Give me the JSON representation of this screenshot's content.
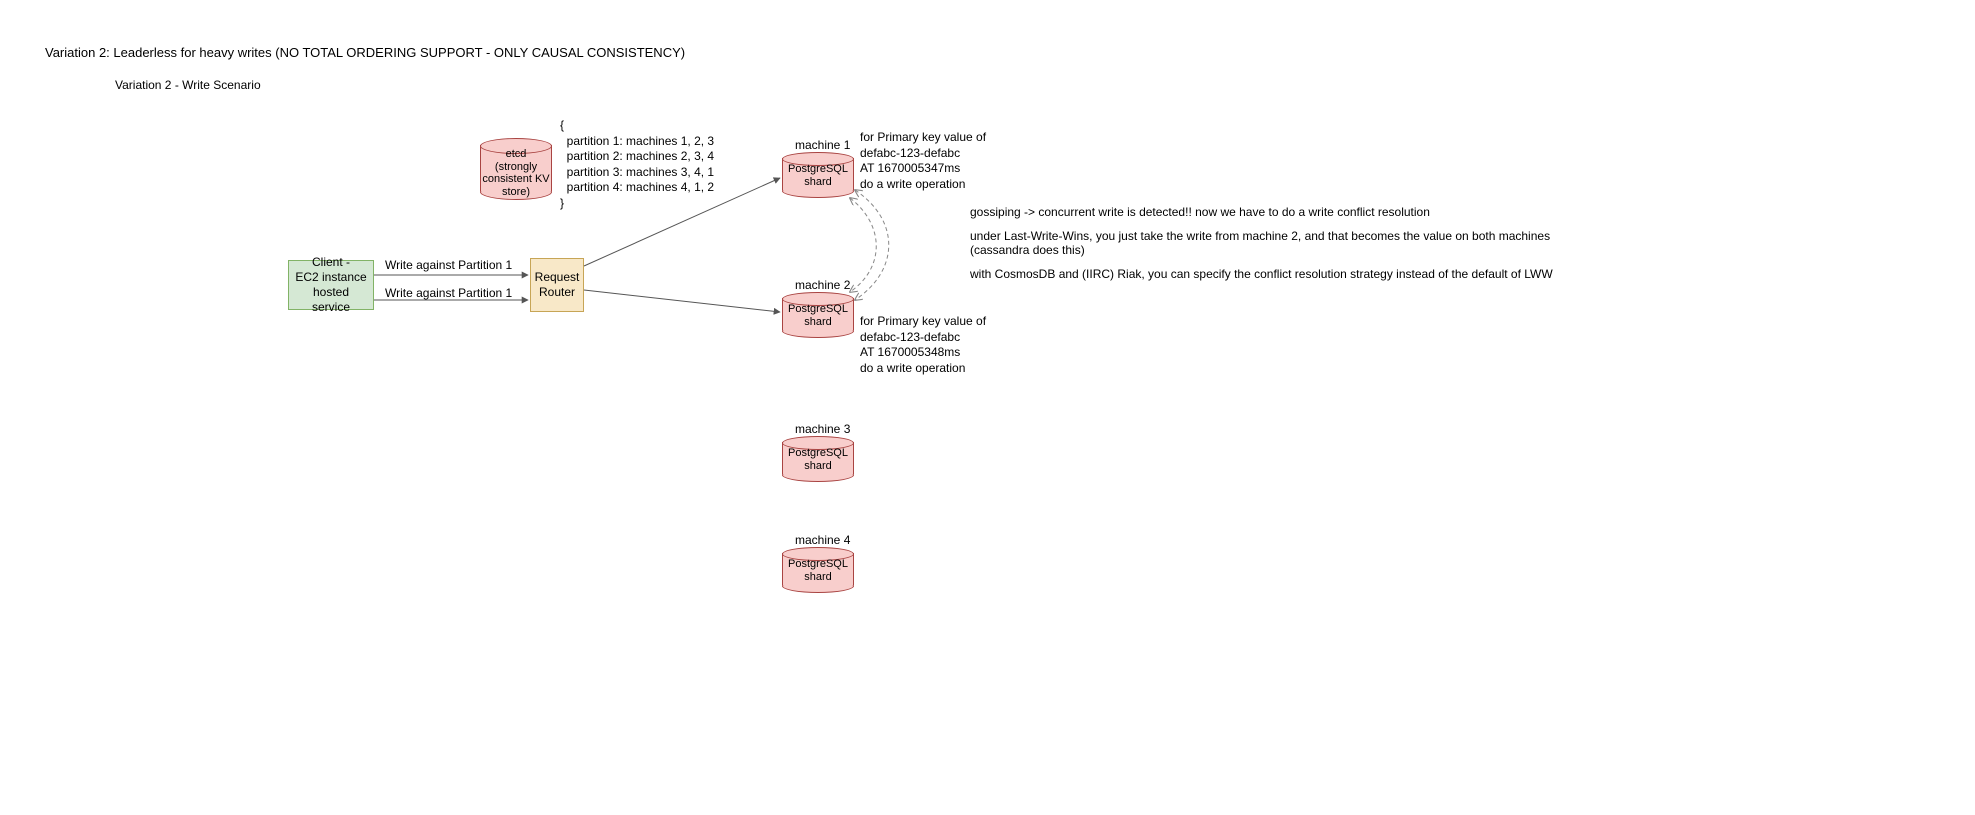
{
  "title": "Variation 2: Leaderless for heavy writes (NO TOTAL ORDERING SUPPORT - ONLY CAUSAL CONSISTENCY)",
  "subtitle": "Variation 2 - Write Scenario",
  "nodes": {
    "client": {
      "label": "Client -\nEC2 instance\nhosted service"
    },
    "router": {
      "label": "Request\nRouter"
    },
    "etcd": {
      "label": "etcd\n(strongly\nconsistent KV\nstore)"
    },
    "shard": {
      "label": "PostgreSQL\nshard"
    }
  },
  "machine_labels": {
    "m1": "machine 1",
    "m2": "machine 2",
    "m3": "machine 3",
    "m4": "machine 4"
  },
  "edge_labels": {
    "write1": "Write against Partition 1",
    "write2": "Write against Partition 1"
  },
  "partition_map": "{\n  partition 1: machines 1, 2, 3\n  partition 2: machines 2, 3, 4\n  partition 3: machines 3, 4, 1\n  partition 4: machines 4, 1, 2\n}",
  "writeops": {
    "m1": "for Primary key value of\ndefabc-123-defabc\nAT 1670005347ms\ndo a write operation",
    "m2": "for Primary key value of\ndefabc-123-defabc\nAT 1670005348ms\ndo a write operation"
  },
  "notes": {
    "line1": "gossiping -> concurrent write is detected!! now we have to do a write conflict resolution",
    "line2": "under Last-Write-Wins, you just take the write from machine 2, and that becomes the value on both machines (cassandra does this)",
    "line3": "with CosmosDB and (IIRC) Riak, you can specify the conflict resolution strategy instead of the default of LWW"
  },
  "colors": {
    "pink_fill": "#f8cecc",
    "pink_stroke": "#a94442",
    "green_fill": "#d5e8d4",
    "green_stroke": "#82b366",
    "tan_fill": "#f8e8c8",
    "tan_stroke": "#c7a556"
  }
}
